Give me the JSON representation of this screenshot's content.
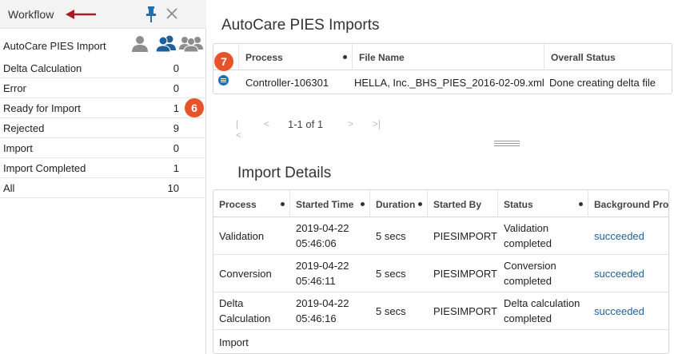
{
  "workflow": {
    "title": "Workflow",
    "import_label": "AutoCare PIES Import",
    "items": [
      {
        "label": "Delta Calculation",
        "count": "0"
      },
      {
        "label": "Error",
        "count": "0"
      },
      {
        "label": "Ready for Import",
        "count": "1"
      },
      {
        "label": "Rejected",
        "count": "9"
      },
      {
        "label": "Import",
        "count": "0"
      },
      {
        "label": "Import Completed",
        "count": "1"
      },
      {
        "label": "All",
        "count": "10"
      }
    ]
  },
  "callouts": {
    "six": "6",
    "seven": "7"
  },
  "imports": {
    "title": "AutoCare PIES Imports",
    "headers": {
      "process": "Process",
      "file_name": "File Name",
      "overall_status": "Overall Status"
    },
    "row": {
      "process": "Controller-106301",
      "file_name": "HELLA, Inc._BHS_PIES_2016-02-09.xml",
      "overall_status": "Done creating delta file"
    }
  },
  "pager": {
    "first": "|<",
    "prev": "<",
    "info": "1-1 of 1",
    "next": ">",
    "last": ">|"
  },
  "details": {
    "title": "Import Details",
    "headers": {
      "process": "Process",
      "started_time": "Started Time",
      "duration": "Duration",
      "started_by": "Started By",
      "status": "Status",
      "background": "Background Pro"
    },
    "rows": [
      {
        "process": "Validation",
        "date": "2019-04-22",
        "time": "05:46:06",
        "duration": "5 secs",
        "started_by": "PIESIMPORT",
        "status1": "Validation",
        "status2": "completed",
        "background": "succeeded"
      },
      {
        "process": "Conversion",
        "date": "2019-04-22",
        "time": "05:46:11",
        "duration": "5 secs",
        "started_by": "PIESIMPORT",
        "status1": "Conversion",
        "status2": "completed",
        "background": "succeeded"
      },
      {
        "process1": "Delta",
        "process2": "Calculation",
        "date": "2019-04-22",
        "time": "05:46:16",
        "duration": "5 secs",
        "started_by": "PIESIMPORT",
        "status1": "Delta calculation",
        "status2": "completed",
        "background": "succeeded"
      },
      {
        "process": "Import"
      }
    ]
  },
  "colors": {
    "accent": "#1f5f9e",
    "callout": "#e8542a",
    "arrow": "#a51d24"
  }
}
